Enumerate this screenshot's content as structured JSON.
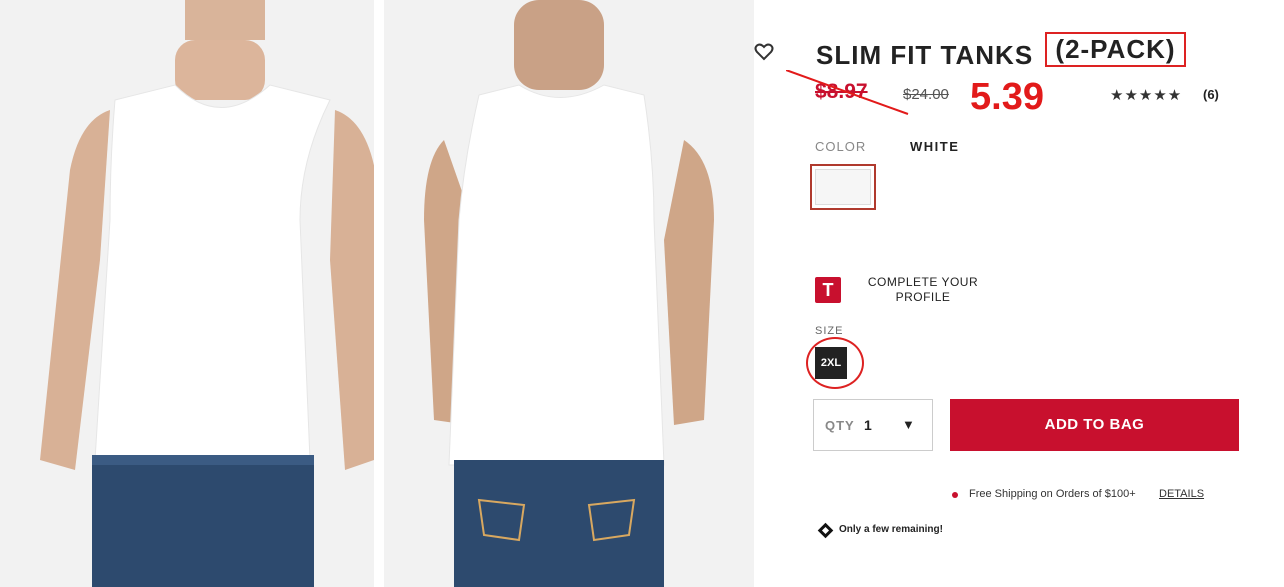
{
  "product": {
    "title": "SLIM FIT TANKS",
    "pack": "(2-PACK)",
    "price_sale": "$8.97",
    "price_original": "$24.00",
    "price_annotation": "5.39",
    "rating_stars": "★★★★★",
    "review_count": "(6)"
  },
  "color": {
    "label": "COLOR",
    "value": "WHITE"
  },
  "profile": {
    "icon_letter": "T",
    "text": "COMPLETE YOUR PROFILE"
  },
  "size": {
    "label": "SIZE",
    "value": "2XL"
  },
  "qty": {
    "label": "QTY",
    "value": "1",
    "caret": "▼"
  },
  "add_to_bag": "ADD TO BAG",
  "shipping": {
    "text": "Free Shipping on Orders of $100+",
    "link": "DETAILS"
  },
  "stock": {
    "text": "Only a few remaining!"
  },
  "colors": {
    "brand": "#c8102e",
    "annotation": "#e21a1a"
  }
}
